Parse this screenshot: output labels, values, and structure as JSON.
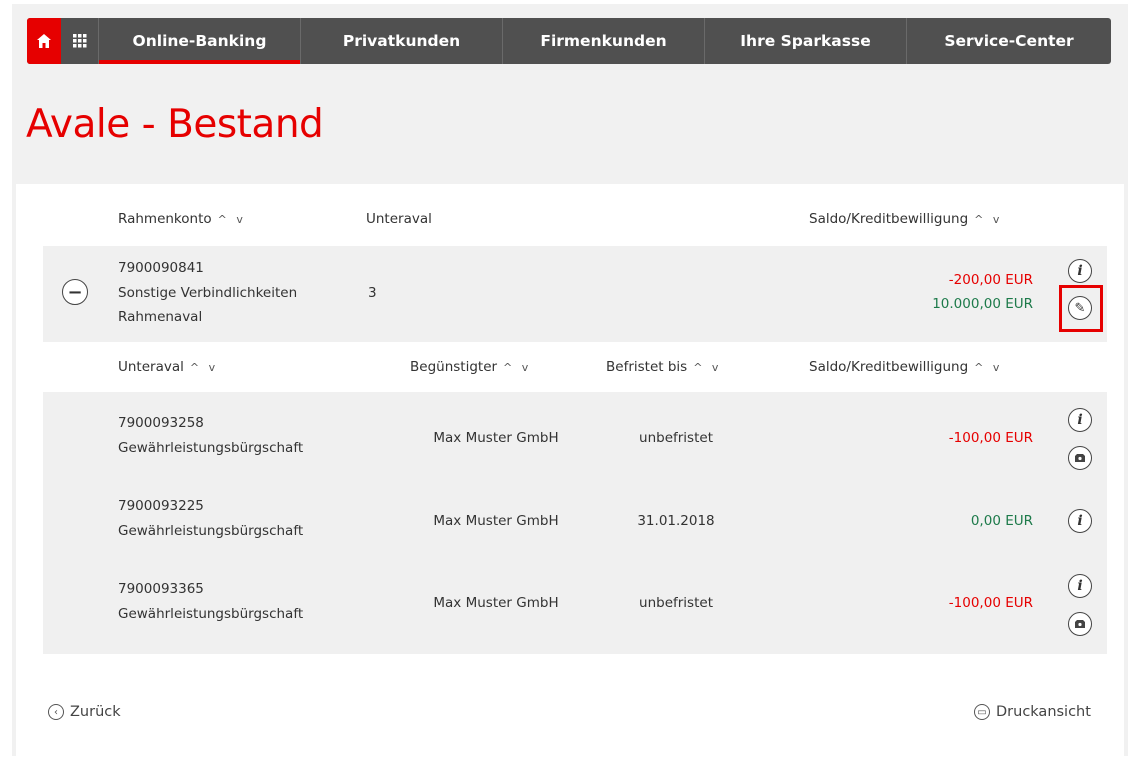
{
  "nav": {
    "items": [
      {
        "label": "Online-Banking",
        "active": true
      },
      {
        "label": "Privatkunden"
      },
      {
        "label": "Firmenkunden"
      },
      {
        "label": "Ihre Sparkasse"
      },
      {
        "label": "Service-Center"
      }
    ],
    "icons": {
      "home": "home-icon",
      "apps": "grid-icon"
    }
  },
  "page_title": "Avale - Bestand",
  "table": {
    "headers": {
      "rahmenkonto": "Rahmenkonto",
      "unteraval": "Unteraval",
      "saldo": "Saldo/Kreditbewilligung"
    },
    "main_row": {
      "account": "7900090841",
      "type": "Sonstige Verbindlichkeiten",
      "subtype": "Rahmenaval",
      "count": "3",
      "saldo": "-200,00 EUR",
      "kredit": "10.000,00 EUR"
    },
    "sub_headers": {
      "unteraval": "Unteraval",
      "beguenstigter": "Begünstigter",
      "befristet": "Befristet bis",
      "saldo": "Saldo/Kreditbewilligung"
    },
    "sub_rows": [
      {
        "account": "7900093258",
        "type": "Gewährleistungsbürgschaft",
        "beneficiary": "Max Muster GmbH",
        "until": "unbefristet",
        "amount": "-100,00 EUR"
      },
      {
        "account": "7900093225",
        "type": "Gewährleistungsbürgschaft",
        "beneficiary": "Max Muster GmbH",
        "until": "31.01.2018",
        "amount": "0,00 EUR"
      },
      {
        "account": "7900093365",
        "type": "Gewährleistungsbürgschaft",
        "beneficiary": "Max Muster GmbH",
        "until": "unbefristet",
        "amount": "-100,00 EUR"
      }
    ],
    "sort_glyph": "^ v",
    "info_glyph": "i",
    "edit_glyph": "✎",
    "collapse_glyph": "−"
  },
  "footer": {
    "back_label": "Zurück",
    "print_label": "Druckansicht"
  },
  "colors": {
    "accent": "#e60000",
    "nav_bg": "#505050",
    "positive": "#1d7a4a"
  }
}
